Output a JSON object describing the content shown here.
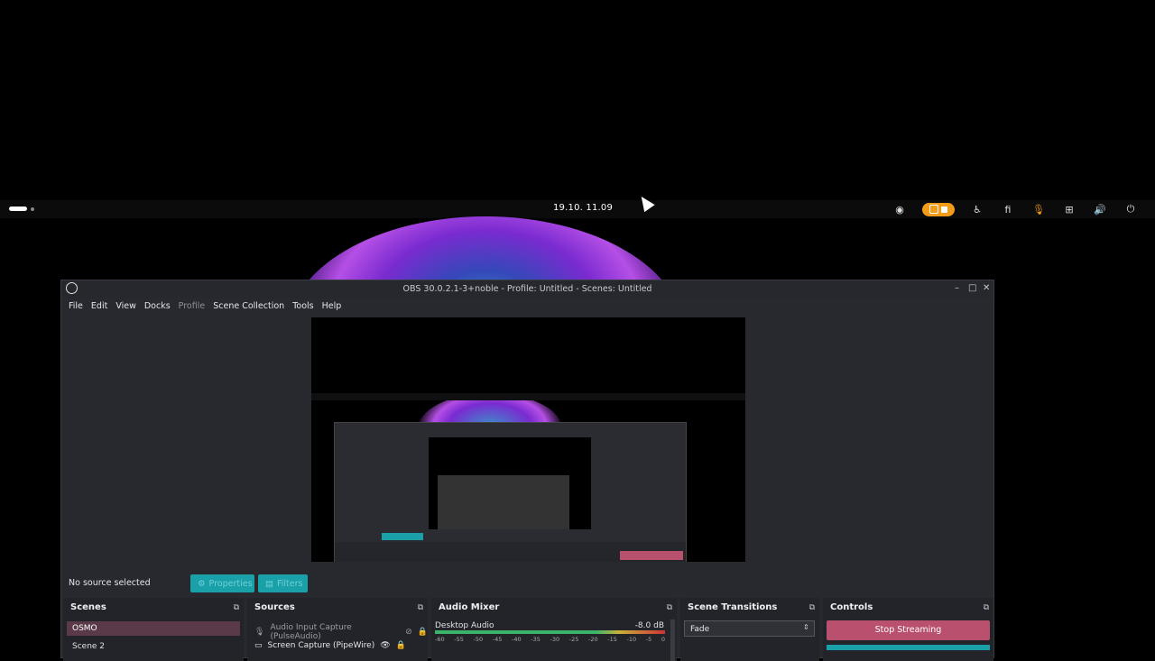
{
  "topbar": {
    "clock": "19.10.  11.09",
    "keyboard_layout": "fi"
  },
  "obs": {
    "title": "OBS 30.0.2.1-3+noble - Profile: Untitled - Scenes: Untitled",
    "window_controls": {
      "minimize": "–",
      "maximize": "□",
      "close": "✕"
    },
    "menu": [
      "File",
      "Edit",
      "View",
      "Docks",
      "Profile",
      "Scene Collection",
      "Tools",
      "Help"
    ],
    "status": {
      "no_source": "No source selected",
      "properties": "Properties",
      "filters": "Filters"
    },
    "docks": {
      "scenes": {
        "title": "Scenes",
        "items": [
          "OSMO",
          "Scene 2"
        ]
      },
      "sources": {
        "title": "Sources",
        "items": [
          "Audio Input Capture (PulseAudio)",
          "Screen Capture (PipeWire)"
        ]
      },
      "audio_mixer": {
        "title": "Audio Mixer",
        "channel": "Desktop Audio",
        "level": "-8.0 dB",
        "ticks": [
          "-60",
          "-55",
          "-50",
          "-45",
          "-40",
          "-35",
          "-30",
          "-25",
          "-20",
          "-15",
          "-10",
          "-5",
          "0"
        ]
      },
      "transitions": {
        "title": "Scene Transitions",
        "selected": "Fade"
      },
      "controls": {
        "title": "Controls",
        "stop_streaming": "Stop Streaming"
      }
    }
  },
  "colors": {
    "accent_teal": "#1aa0a8",
    "stop_pink": "#b8506e",
    "tray_orange": "#f39c1a",
    "selected_scene": "#5a3a48"
  }
}
